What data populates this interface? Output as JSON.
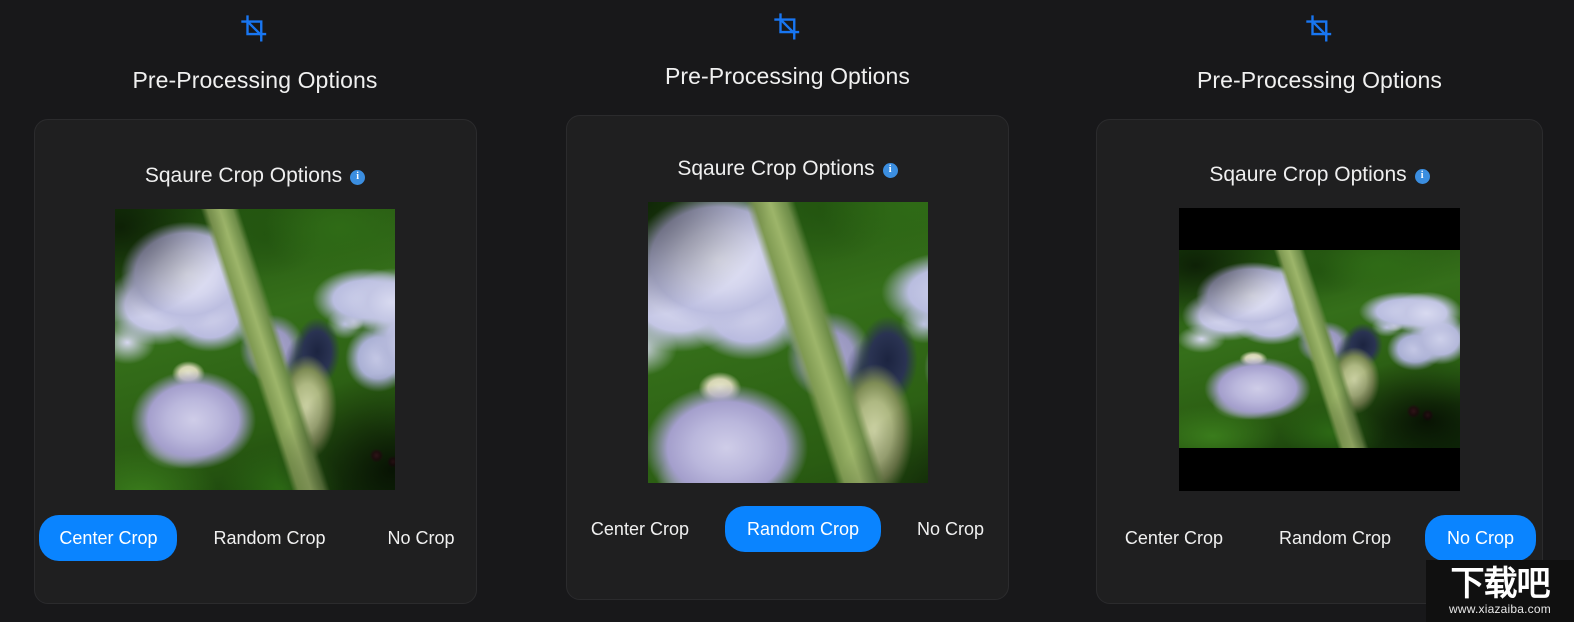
{
  "theme": {
    "page_background": "#18181a",
    "card_background": "#1f1f20",
    "accent_blue": "#0a84ff",
    "info_blue": "#3b8ee0",
    "text_primary": "#f0f0f0"
  },
  "panels": [
    {
      "icon": "crop-icon",
      "title": "Pre-Processing Options",
      "card_title": "Sqaure Crop Options",
      "info_glyph": "i",
      "preview": {
        "mode": "square",
        "alt": "iris-flower-photo-center-crop",
        "letterboxed": false
      },
      "options": [
        {
          "label": "Center Crop",
          "selected": true
        },
        {
          "label": "Random Crop",
          "selected": false
        },
        {
          "label": "No Crop",
          "selected": false
        }
      ]
    },
    {
      "icon": "crop-icon",
      "title": "Pre-Processing Options",
      "card_title": "Sqaure Crop Options",
      "info_glyph": "i",
      "preview": {
        "mode": "square",
        "alt": "iris-flower-photo-random-crop",
        "letterboxed": false
      },
      "options": [
        {
          "label": "Center Crop",
          "selected": false
        },
        {
          "label": "Random Crop",
          "selected": true
        },
        {
          "label": "No Crop",
          "selected": false
        }
      ]
    },
    {
      "icon": "crop-icon",
      "title": "Pre-Processing Options",
      "card_title": "Sqaure Crop Options",
      "info_glyph": "i",
      "preview": {
        "mode": "letterbox",
        "alt": "iris-flower-photo-uncropped",
        "letterboxed": true
      },
      "options": [
        {
          "label": "Center Crop",
          "selected": false
        },
        {
          "label": "Random Crop",
          "selected": false
        },
        {
          "label": "No Crop",
          "selected": true
        }
      ]
    }
  ],
  "watermark": {
    "logo": "下载吧",
    "url": "www.xiazaiba.com"
  }
}
